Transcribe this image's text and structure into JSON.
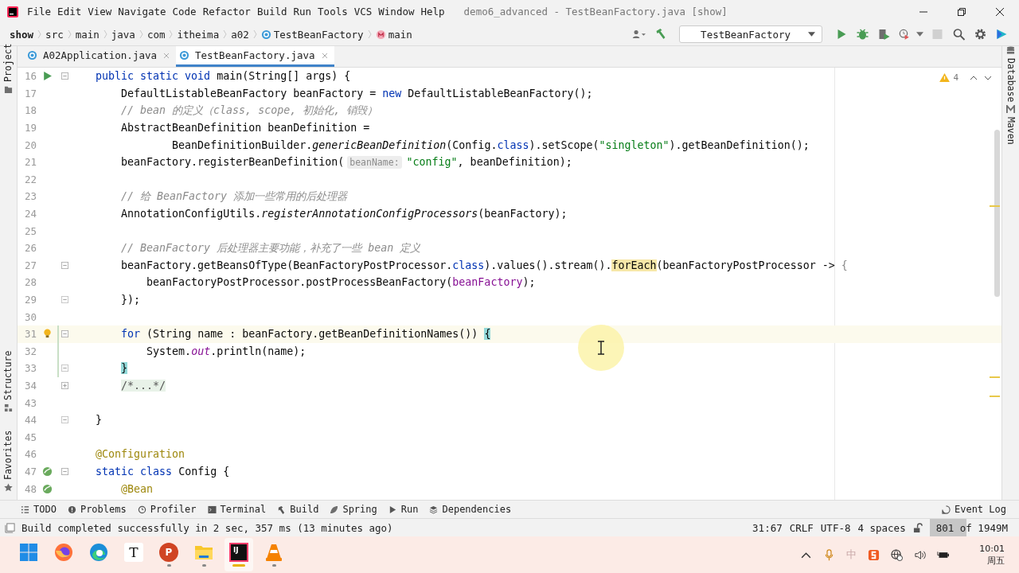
{
  "title_bar": {
    "menus": [
      "File",
      "Edit",
      "View",
      "Navigate",
      "Code",
      "Refactor",
      "Build",
      "Run",
      "Tools",
      "VCS",
      "Window",
      "Help"
    ],
    "title": "demo6_advanced - TestBeanFactory.java [show]"
  },
  "navigation_bar": {
    "breadcrumbs": [
      {
        "label": "show",
        "kind": "root"
      },
      {
        "label": "src",
        "kind": "folder"
      },
      {
        "label": "main",
        "kind": "folder"
      },
      {
        "label": "java",
        "kind": "folder"
      },
      {
        "label": "com",
        "kind": "folder"
      },
      {
        "label": "itheima",
        "kind": "folder"
      },
      {
        "label": "a02",
        "kind": "folder"
      },
      {
        "label": "TestBeanFactory",
        "kind": "class"
      },
      {
        "label": "main",
        "kind": "method"
      }
    ],
    "run_config": "TestBeanFactory"
  },
  "editor_tabs": [
    {
      "label": "A02Application.java",
      "selected": false
    },
    {
      "label": "TestBeanFactory.java",
      "selected": true
    }
  ],
  "left_tool_strip": [
    {
      "label": "Project",
      "kind": "folder"
    },
    {
      "label": "Structure",
      "kind": "structure"
    },
    {
      "label": "Favorites",
      "kind": "star"
    }
  ],
  "right_tool_strip": [
    {
      "label": "Database",
      "kind": "database"
    },
    {
      "label": "Maven",
      "kind": "maven"
    }
  ],
  "editor": {
    "inspection_count": "4",
    "lines": [
      {
        "number": "16",
        "gutter_icon": {
          "kind": "run"
        },
        "fold": {
          "kind": "open"
        },
        "current": false,
        "changed": false,
        "segments": [
          {
            "kind": "keyword",
            "text": "    public static void "
          },
          {
            "kind": "plain",
            "text": "main(String[] args) {"
          }
        ]
      },
      {
        "number": "17",
        "current": false,
        "changed": false,
        "segments": [
          {
            "kind": "plain",
            "text": "        DefaultListableBeanFactory beanFactory = "
          },
          {
            "kind": "keyword",
            "text": "new"
          },
          {
            "kind": "plain",
            "text": " DefaultListableBeanFactory();"
          }
        ]
      },
      {
        "number": "18",
        "current": false,
        "changed": false,
        "segments": [
          {
            "kind": "comment",
            "text": "        // bean 的定义（class, scope, 初始化, 销毁）"
          }
        ]
      },
      {
        "number": "19",
        "current": false,
        "changed": false,
        "segments": [
          {
            "kind": "plain",
            "text": "        AbstractBeanDefinition beanDefinition ="
          }
        ]
      },
      {
        "number": "20",
        "current": false,
        "changed": false,
        "segments": [
          {
            "kind": "plain",
            "text": "                BeanDefinitionBuilder."
          },
          {
            "kind": "static_call",
            "text": "genericBeanDefinition"
          },
          {
            "kind": "plain",
            "text": "(Config."
          },
          {
            "kind": "keyword",
            "text": "class"
          },
          {
            "kind": "plain",
            "text": ").setScope("
          },
          {
            "kind": "string",
            "text": "\"singleton\""
          },
          {
            "kind": "plain",
            "text": ").getBeanDefinition();"
          }
        ]
      },
      {
        "number": "21",
        "current": false,
        "changed": false,
        "segments": [
          {
            "kind": "plain",
            "text": "        beanFactory.registerBeanDefinition("
          },
          {
            "kind": "hint",
            "text": "beanName:"
          },
          {
            "kind": "string",
            "text": "\"config\""
          },
          {
            "kind": "plain",
            "text": ", beanDefinition);"
          }
        ]
      },
      {
        "number": "22",
        "current": false,
        "changed": false
      },
      {
        "number": "23",
        "current": false,
        "changed": false,
        "segments": [
          {
            "kind": "comment",
            "text": "        // 给 BeanFactory 添加一些常用的后处理器"
          }
        ]
      },
      {
        "number": "24",
        "current": false,
        "changed": false,
        "segments": [
          {
            "kind": "plain",
            "text": "        AnnotationConfigUtils."
          },
          {
            "kind": "static_call",
            "text": "registerAnnotationConfigProcessors"
          },
          {
            "kind": "plain",
            "text": "(beanFactory);"
          }
        ]
      },
      {
        "number": "25",
        "current": false,
        "changed": false
      },
      {
        "number": "26",
        "current": false,
        "changed": false,
        "segments": [
          {
            "kind": "comment",
            "text": "        // BeanFactory 后处理器主要功能，补充了一些 bean 定义"
          }
        ]
      },
      {
        "number": "27",
        "fold": {
          "kind": "open"
        },
        "current": false,
        "changed": false,
        "segments": [
          {
            "kind": "plain",
            "text": "        beanFactory.getBeansOfType(BeanFactoryPostProcessor."
          },
          {
            "kind": "keyword",
            "text": "class"
          },
          {
            "kind": "plain",
            "text": ").values().stream()."
          },
          {
            "kind": "highlight",
            "text": "forEach"
          },
          {
            "kind": "plain",
            "text": "(beanFactoryPostProcessor -> "
          },
          {
            "kind": "dim",
            "text": "{"
          }
        ]
      },
      {
        "number": "28",
        "current": false,
        "changed": false,
        "segments": [
          {
            "kind": "plain",
            "text": "            beanFactoryPostProcessor.postProcessBeanFactory("
          },
          {
            "kind": "captured",
            "text": "beanFactory"
          },
          {
            "kind": "plain",
            "text": ");"
          }
        ]
      },
      {
        "number": "29",
        "fold": {
          "kind": "close"
        },
        "current": false,
        "changed": false,
        "segments": [
          {
            "kind": "plain",
            "text": "        });"
          }
        ]
      },
      {
        "number": "30",
        "current": false,
        "changed": false
      },
      {
        "number": "31",
        "gutter_icon": {
          "kind": "bulb"
        },
        "fold": {
          "kind": "open"
        },
        "current": true,
        "changed": true,
        "segments": [
          {
            "kind": "keyword",
            "text": "        for"
          },
          {
            "kind": "plain",
            "text": " (String name : beanFactory.getBeanDefinitionNames()) "
          },
          {
            "kind": "brace",
            "text": "{"
          }
        ]
      },
      {
        "number": "32",
        "current": false,
        "changed": true,
        "segments": [
          {
            "kind": "plain",
            "text": "            System."
          },
          {
            "kind": "static_field",
            "text": "out"
          },
          {
            "kind": "plain",
            "text": ".println(name);"
          }
        ]
      },
      {
        "number": "33",
        "fold": {
          "kind": "close"
        },
        "current": false,
        "changed": true,
        "segments": [
          {
            "kind": "brace",
            "text": "        }"
          }
        ]
      },
      {
        "number": "34",
        "fold": {
          "kind": "collapsed"
        },
        "current": false,
        "changed": false,
        "segments": [
          {
            "kind": "folded",
            "text": "        /*...*/"
          }
        ]
      },
      {
        "number": "43",
        "current": false,
        "changed": false
      },
      {
        "number": "44",
        "fold": {
          "kind": "close"
        },
        "current": false,
        "changed": false,
        "segments": [
          {
            "kind": "plain",
            "text": "    }"
          }
        ]
      },
      {
        "number": "45",
        "current": false,
        "changed": false
      },
      {
        "number": "46",
        "current": false,
        "changed": false,
        "segments": [
          {
            "kind": "annotation",
            "text": "    @Configuration"
          }
        ]
      },
      {
        "number": "47",
        "gutter_icon": {
          "kind": "bean"
        },
        "fold": {
          "kind": "open"
        },
        "current": false,
        "changed": false,
        "segments": [
          {
            "kind": "keyword",
            "text": "    static class"
          },
          {
            "kind": "plain",
            "text": " Config {"
          }
        ]
      },
      {
        "number": "48",
        "gutter_icon": {
          "kind": "bean"
        },
        "current": false,
        "changed": false,
        "segments": [
          {
            "kind": "annotation",
            "text": "        @Bean"
          }
        ]
      }
    ]
  },
  "tool_windows": [
    {
      "label": "TODO",
      "kind": "list"
    },
    {
      "label": "Problems",
      "kind": "problems"
    },
    {
      "label": "Profiler",
      "kind": "profiler"
    },
    {
      "label": "Terminal",
      "kind": "terminal"
    },
    {
      "label": "Build",
      "kind": "hammer"
    },
    {
      "label": "Spring",
      "kind": "spring"
    },
    {
      "label": "Run",
      "kind": "run"
    },
    {
      "label": "Dependencies",
      "kind": "layers"
    }
  ],
  "event_log": "Event Log",
  "status_bar": {
    "message": "Build completed successfully in 2 sec, 357 ms (13 minutes ago)",
    "position": "31:67",
    "line_separator": "CRLF",
    "encoding": "UTF-8",
    "indent": "4 spaces",
    "memory": {
      "text": "801 of 1949M",
      "level": 0.41
    }
  },
  "taskbar": {
    "apps": [
      {
        "kind": "start",
        "running": false,
        "active": false
      },
      {
        "kind": "firefox",
        "running": false,
        "active": false
      },
      {
        "kind": "edge",
        "running": false,
        "active": false
      },
      {
        "kind": "typora",
        "label": "T",
        "running": false,
        "active": false
      },
      {
        "kind": "powerpoint",
        "label": "P",
        "running": true,
        "active": false
      },
      {
        "kind": "explorer",
        "running": true,
        "active": false
      },
      {
        "kind": "intellij",
        "label": "IJ",
        "running": true,
        "active": true
      },
      {
        "kind": "vlc",
        "running": true,
        "active": false
      }
    ],
    "input_mode": "中",
    "clock": {
      "time": "10:01",
      "day": "周五"
    }
  }
}
